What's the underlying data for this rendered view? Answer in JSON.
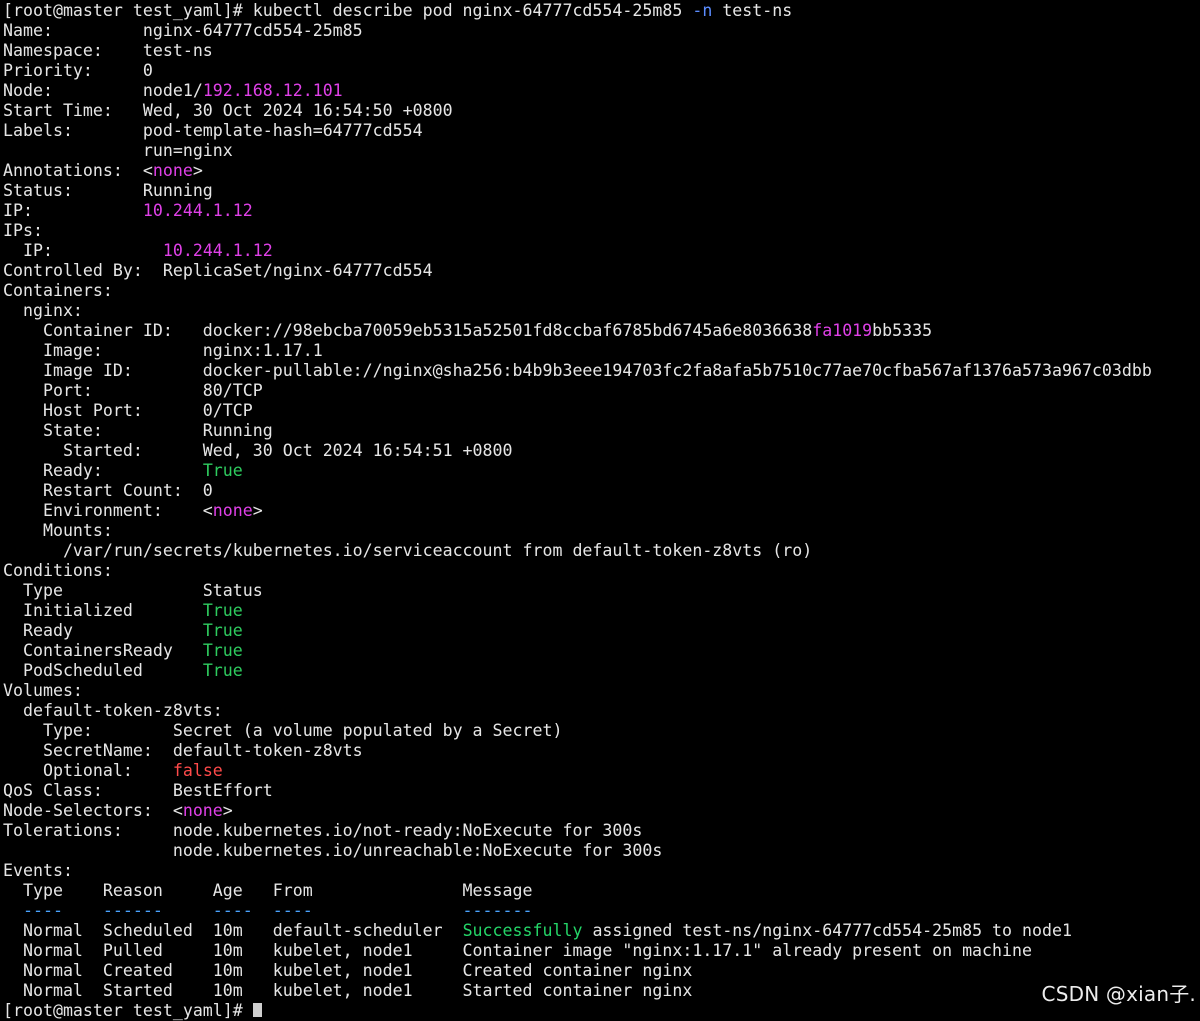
{
  "colors": {
    "background": "#000000",
    "text": "#e6e6e6",
    "highlight_magenta": "#e040e8",
    "status_true_green": "#2ecc5f",
    "success_green": "#24d668",
    "false_red": "#ff4a4a",
    "flag_blue": "#5b8cff",
    "separator_blue": "#4aa3ff"
  },
  "terminal": {
    "lines": [
      [
        {
          "t": "[root@master test_yaml]# kubectl describe pod nginx-64777cd554-25m85 ",
          "c": "white"
        },
        {
          "t": "-n",
          "c": "blue"
        },
        {
          "t": " test-ns",
          "c": "white"
        }
      ],
      [
        {
          "t": "Name:         nginx-64777cd554-25m85",
          "c": "white"
        }
      ],
      [
        {
          "t": "Namespace:    test-ns",
          "c": "white"
        }
      ],
      [
        {
          "t": "Priority:     0",
          "c": "white"
        }
      ],
      [
        {
          "t": "Node:         node1/",
          "c": "white"
        },
        {
          "t": "192.168.12.101",
          "c": "magenta"
        }
      ],
      [
        {
          "t": "Start Time:   Wed, 30 Oct 2024 16:54:50 +0800",
          "c": "white"
        }
      ],
      [
        {
          "t": "Labels:       pod-template-hash=64777cd554",
          "c": "white"
        }
      ],
      [
        {
          "t": "              run=nginx",
          "c": "white"
        }
      ],
      [
        {
          "t": "Annotations:  <",
          "c": "white"
        },
        {
          "t": "none",
          "c": "magenta"
        },
        {
          "t": ">",
          "c": "white"
        }
      ],
      [
        {
          "t": "Status:       Running",
          "c": "white"
        }
      ],
      [
        {
          "t": "IP:           ",
          "c": "white"
        },
        {
          "t": "10.244.1.12",
          "c": "magenta"
        }
      ],
      [
        {
          "t": "IPs:",
          "c": "white"
        }
      ],
      [
        {
          "t": "  IP:           ",
          "c": "white"
        },
        {
          "t": "10.244.1.12",
          "c": "magenta"
        }
      ],
      [
        {
          "t": "Controlled By:  ReplicaSet/nginx-64777cd554",
          "c": "white"
        }
      ],
      [
        {
          "t": "Containers:",
          "c": "white"
        }
      ],
      [
        {
          "t": "  nginx:",
          "c": "white"
        }
      ],
      [
        {
          "t": "    Container ID:   docker://98ebcba70059eb5315a52501fd8ccbaf6785bd6745a6e8036638",
          "c": "white"
        },
        {
          "t": "fa1019",
          "c": "magenta"
        },
        {
          "t": "bb5335",
          "c": "white"
        }
      ],
      [
        {
          "t": "    Image:          nginx:1.17.1",
          "c": "white"
        }
      ],
      [
        {
          "t": "    Image ID:       docker-pullable://nginx@sha256:b4b9b3eee194703fc2fa8afa5b7510c77ae70cfba567af1376a573a967c03dbb",
          "c": "white"
        }
      ],
      [
        {
          "t": "    Port:           80/TCP",
          "c": "white"
        }
      ],
      [
        {
          "t": "    Host Port:      0/TCP",
          "c": "white"
        }
      ],
      [
        {
          "t": "    State:          Running",
          "c": "white"
        }
      ],
      [
        {
          "t": "      Started:      Wed, 30 Oct 2024 16:54:51 +0800",
          "c": "white"
        }
      ],
      [
        {
          "t": "    Ready:          ",
          "c": "white"
        },
        {
          "t": "True",
          "c": "green"
        }
      ],
      [
        {
          "t": "    Restart Count:  0",
          "c": "white"
        }
      ],
      [
        {
          "t": "    Environment:    <",
          "c": "white"
        },
        {
          "t": "none",
          "c": "magenta"
        },
        {
          "t": ">",
          "c": "white"
        }
      ],
      [
        {
          "t": "    Mounts:",
          "c": "white"
        }
      ],
      [
        {
          "t": "      /var/run/secrets/kubernetes.io/serviceaccount from default-token-z8vts (ro)",
          "c": "white"
        }
      ],
      [
        {
          "t": "Conditions:",
          "c": "white"
        }
      ],
      [
        {
          "t": "  Type              Status",
          "c": "white"
        }
      ],
      [
        {
          "t": "  Initialized       ",
          "c": "white"
        },
        {
          "t": "True",
          "c": "green"
        }
      ],
      [
        {
          "t": "  Ready             ",
          "c": "white"
        },
        {
          "t": "True",
          "c": "green"
        }
      ],
      [
        {
          "t": "  ContainersReady   ",
          "c": "white"
        },
        {
          "t": "True",
          "c": "green"
        }
      ],
      [
        {
          "t": "  PodScheduled      ",
          "c": "white"
        },
        {
          "t": "True",
          "c": "green"
        }
      ],
      [
        {
          "t": "Volumes:",
          "c": "white"
        }
      ],
      [
        {
          "t": "  default-token-z8vts:",
          "c": "white"
        }
      ],
      [
        {
          "t": "    Type:        Secret (a volume populated by a Secret)",
          "c": "white"
        }
      ],
      [
        {
          "t": "    SecretName:  default-token-z8vts",
          "c": "white"
        }
      ],
      [
        {
          "t": "    Optional:    ",
          "c": "white"
        },
        {
          "t": "false",
          "c": "red"
        }
      ],
      [
        {
          "t": "QoS Class:       BestEffort",
          "c": "white"
        }
      ],
      [
        {
          "t": "Node-Selectors:  <",
          "c": "white"
        },
        {
          "t": "none",
          "c": "magenta"
        },
        {
          "t": ">",
          "c": "white"
        }
      ],
      [
        {
          "t": "Tolerations:     node.kubernetes.io/not-ready:NoExecute for 300s",
          "c": "white"
        }
      ],
      [
        {
          "t": "                 node.kubernetes.io/unreachable:NoExecute for 300s",
          "c": "white"
        }
      ],
      [
        {
          "t": "Events:",
          "c": "white"
        }
      ],
      [
        {
          "t": "  Type    Reason     Age   From               Message",
          "c": "white"
        }
      ],
      [
        {
          "t": "  ----    ------     ----  ----               -------",
          "c": "dash"
        }
      ],
      [
        {
          "t": "  Normal  Scheduled  10m   default-scheduler  ",
          "c": "white"
        },
        {
          "t": "Successfully",
          "c": "bright-green"
        },
        {
          "t": " assigned test-ns/nginx-64777cd554-25m85 to node1",
          "c": "white"
        }
      ],
      [
        {
          "t": "  Normal  Pulled     10m   kubelet, node1     Container image \"nginx:1.17.1\" already present on machine",
          "c": "white"
        }
      ],
      [
        {
          "t": "  Normal  Created    10m   kubelet, node1     Created container nginx",
          "c": "white"
        }
      ],
      [
        {
          "t": "  Normal  Started    10m   kubelet, node1     Started container nginx",
          "c": "white"
        }
      ],
      [
        {
          "t": "[root@master test_yaml]# ",
          "c": "white"
        },
        {
          "t": "",
          "c": "cursor"
        }
      ]
    ]
  },
  "watermark": {
    "text": "CSDN @xian子."
  }
}
